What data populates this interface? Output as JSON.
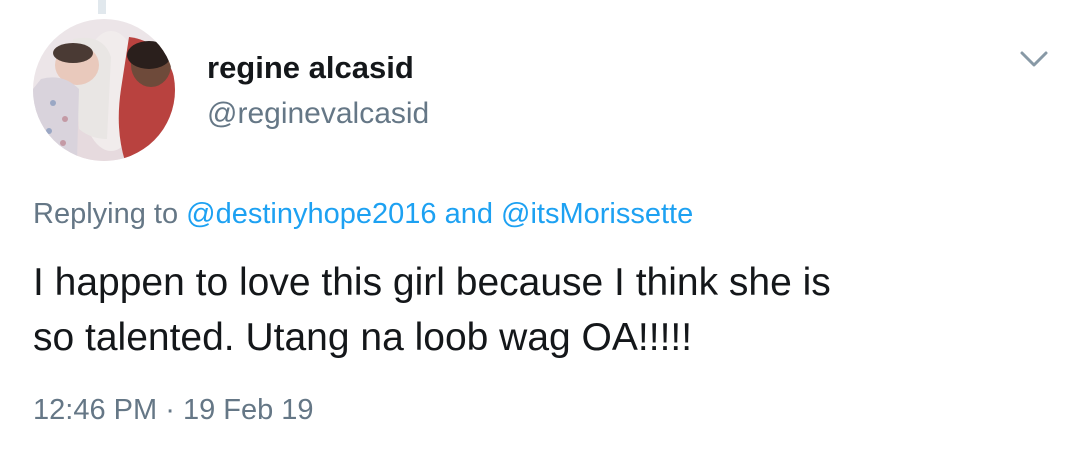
{
  "tweet": {
    "author": {
      "display_name": "regine alcasid",
      "handle": "@reginevalcasid",
      "avatar": "avatar-photo"
    },
    "replying": {
      "prefix": "Replying to",
      "mention_1": "@destinyhope2016",
      "joiner": "and",
      "mention_2": "@itsMorissette"
    },
    "text_line_1": "I happen to love this girl because I think she is",
    "text_line_2": "so talented. Utang na loob wag OA!!!!!",
    "time": "12:46 PM",
    "separator": "·",
    "date": "19 Feb 19",
    "menu_icon": "chevron-down-icon"
  },
  "colors": {
    "text": "#14171a",
    "muted": "#657786",
    "link": "#1da1f2",
    "background": "#ffffff"
  }
}
